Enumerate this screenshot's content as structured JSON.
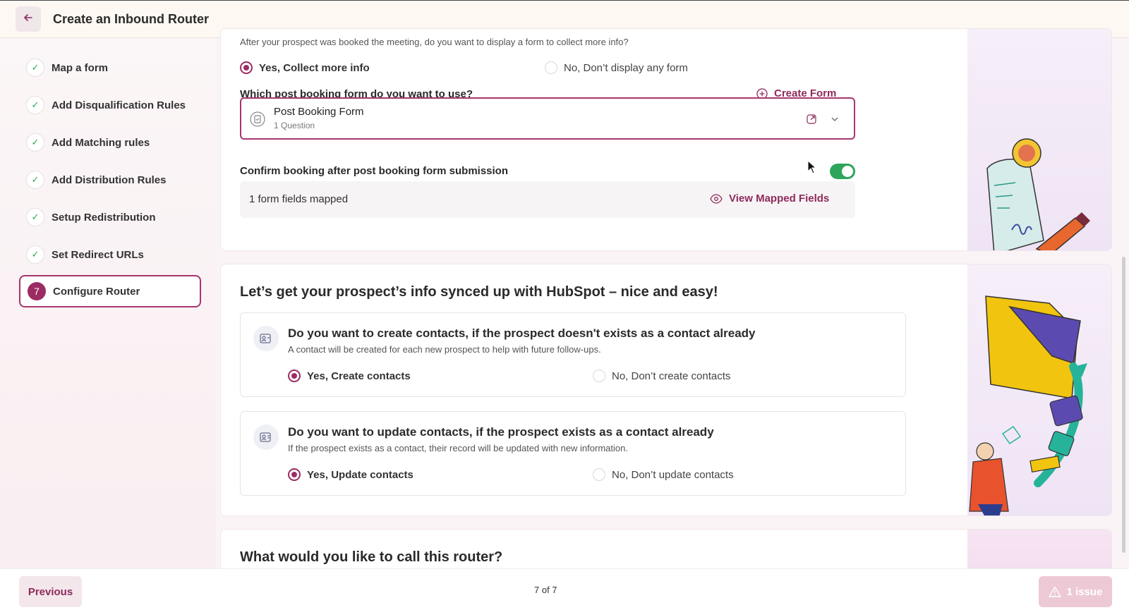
{
  "header": {
    "back_icon": "arrow-left-icon",
    "title": "Create an Inbound Router"
  },
  "sidebar": {
    "steps": [
      {
        "label": "Map a form",
        "status": "done"
      },
      {
        "label": "Add Disqualification Rules",
        "status": "done"
      },
      {
        "label": "Add Matching rules",
        "status": "done"
      },
      {
        "label": "Add Distribution Rules",
        "status": "done"
      },
      {
        "label": "Setup Redistribution",
        "status": "done"
      },
      {
        "label": "Set Redirect URLs",
        "status": "done"
      },
      {
        "label": "Configure Router",
        "status": "active",
        "number": "7"
      }
    ]
  },
  "post_booking": {
    "question": "After your prospect was booked the meeting, do you want to display a form to collect more info?",
    "option_yes": "Yes, Collect more info",
    "option_no": "No, Don’t display any form",
    "form_question": "Which post booking form do you want to use?",
    "create_form": "Create Form",
    "selected_form_name": "Post Booking Form",
    "selected_form_sub": "1 Question",
    "confirm_label": "Confirm booking after post booking form submission",
    "confirm_enabled": true,
    "mapped_count": "1 form fields mapped",
    "view_mapped": "View Mapped Fields"
  },
  "hubspot": {
    "title": "Let’s get your prospect’s info synced up with HubSpot – nice and easy!",
    "create": {
      "question": "Do you want to create contacts, if the prospect doesn't exists as a contact already",
      "description": "A contact will be created for each new prospect to help with future follow-ups.",
      "option_yes": "Yes, Create contacts",
      "option_no": "No, Don’t create contacts"
    },
    "update": {
      "question": "Do you want to update contacts, if the prospect exists as a contact already",
      "description": "If the prospect exists as a contact, their record will be updated with new information.",
      "option_yes": "Yes, Update contacts",
      "option_no": "No, Don’t update contacts"
    }
  },
  "router_name": {
    "title": "What would you like to call this router?"
  },
  "footer": {
    "previous": "Previous",
    "page_indicator": "7 of 7",
    "issues": "1 issue"
  },
  "colors": {
    "brand": "#9b2c63",
    "toggle_on": "#2ea55a"
  }
}
